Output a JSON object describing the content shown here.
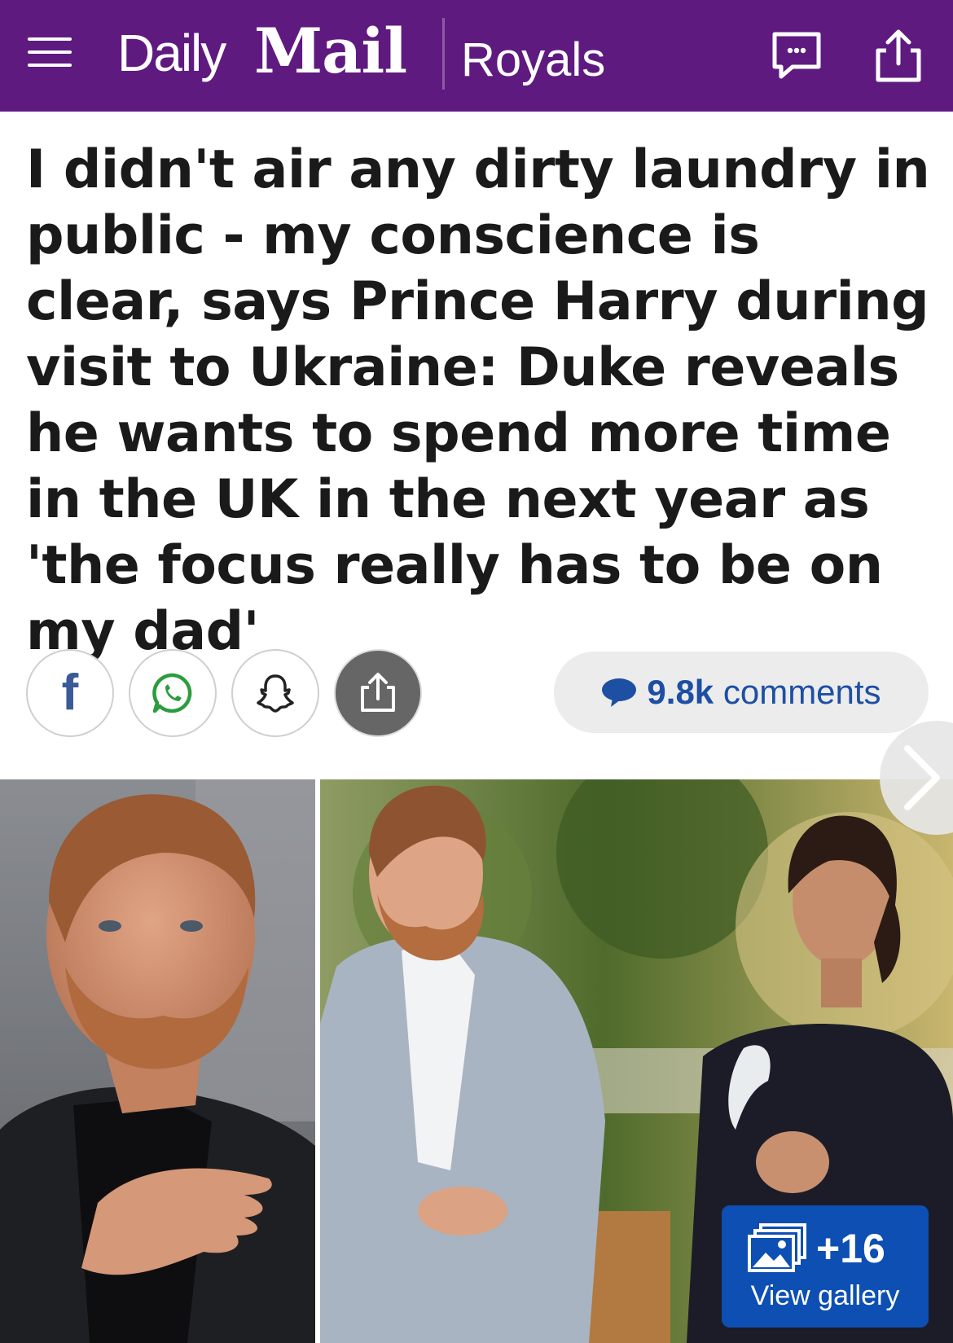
{
  "header": {
    "logo_daily": "Daily",
    "logo_mail": "Mail",
    "section": "Royals",
    "background": "#5f1a80"
  },
  "article": {
    "headline": "I didn't air any dirty laundry in public - my conscience is clear, says Prince Harry during visit to Ukraine: Duke reveals he wants to spend more time in the UK in the next year as 'the focus really has to be on my dad'"
  },
  "share": {
    "facebook_glyph": "f",
    "comments_count": "9.8k",
    "comments_label": "comments"
  },
  "gallery": {
    "count": "+16",
    "label": "View gallery"
  },
  "icons": [
    "menu-icon",
    "comment-icon",
    "share-icon",
    "whatsapp-icon",
    "snapchat-icon",
    "next-arrow-icon",
    "gallery-icon"
  ],
  "colors": {
    "accent": "#5f1a80",
    "link": "#1d4fa3",
    "gallery_button": "#0d4fb3"
  }
}
